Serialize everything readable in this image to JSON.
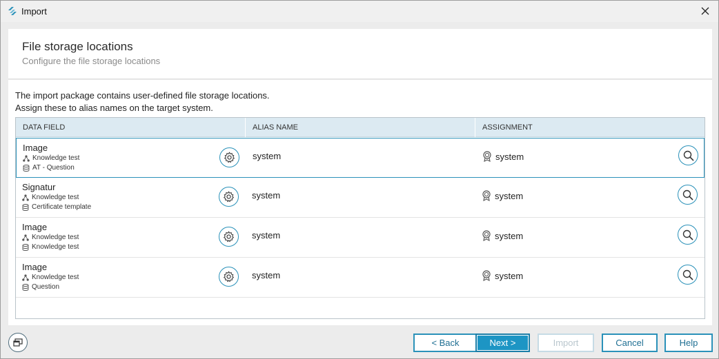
{
  "window": {
    "title": "Import"
  },
  "header": {
    "title": "File storage locations",
    "subtitle": "Configure the file storage locations"
  },
  "content": {
    "description_line1": "The import package contains user-defined file storage locations.",
    "description_line2": "Assign these to alias names on the target system."
  },
  "grid": {
    "columns": [
      "DATA FIELD",
      "ALIAS NAME",
      "ASSIGNMENT"
    ],
    "rows": [
      {
        "name": "Image",
        "group": "Knowledge test",
        "source": "AT - Question",
        "alias": "system",
        "assignment": "system",
        "selected": true
      },
      {
        "name": "Signatur",
        "group": "Knowledge test",
        "source": "Certificate template",
        "alias": "system",
        "assignment": "system",
        "selected": false
      },
      {
        "name": "Image",
        "group": "Knowledge test",
        "source": "Knowledge test",
        "alias": "system",
        "assignment": "system",
        "selected": false
      },
      {
        "name": "Image",
        "group": "Knowledge test",
        "source": "Question",
        "alias": "system",
        "assignment": "system",
        "selected": false
      }
    ]
  },
  "footer": {
    "back_label": "< Back",
    "next_label": "Next >",
    "import_label": "Import",
    "cancel_label": "Cancel",
    "help_label": "Help"
  },
  "colors": {
    "accent": "#2a91b9",
    "primary_button": "#1d95c4",
    "grid_header": "#dceaf2",
    "disabled": "#b9c6cd"
  },
  "icons": [
    "app-logo-icon",
    "close-icon",
    "gear-icon",
    "search-icon",
    "network-icon",
    "database-icon",
    "badge-icon",
    "window-switch-icon"
  ]
}
